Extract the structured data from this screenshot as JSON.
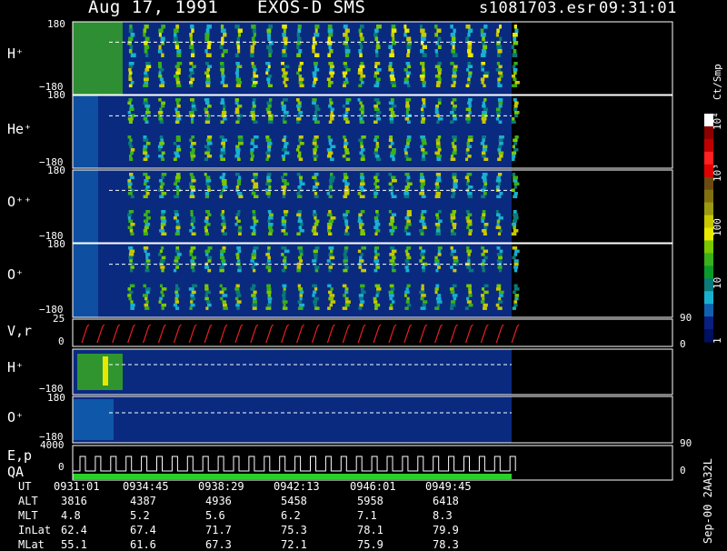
{
  "header": {
    "date": "Aug 17, 1991",
    "instrument": "EXOS-D SMS",
    "file": "s1081703.esr",
    "time": "09:31:01"
  },
  "colorbar": {
    "unit": "Ct/Smp",
    "ticks": [
      "1",
      "10",
      "100",
      "10³",
      "10⁴"
    ],
    "colors": [
      "#ffffff",
      "#8b0000",
      "#c00000",
      "#ff2020",
      "#e00000",
      "#6b4a12",
      "#807010",
      "#9a9a10",
      "#c8c800",
      "#e8e800",
      "#7ac800",
      "#3ab01a",
      "#0a9a2a",
      "#0a7a7a",
      "#19b0d0",
      "#1060b0",
      "#0a2080",
      "#001060"
    ]
  },
  "chart_data": [
    {
      "type": "heatmap",
      "panel": "H+",
      "label": "H⁺",
      "ylim": [
        -180,
        180
      ],
      "y_ticks": [
        "180",
        "−180"
      ]
    },
    {
      "type": "heatmap",
      "panel": "He+",
      "label": "He⁺",
      "ylim": [
        -180,
        180
      ],
      "y_ticks": [
        "180",
        "−180"
      ]
    },
    {
      "type": "heatmap",
      "panel": "O++",
      "label": "O⁺⁺",
      "ylim": [
        -180,
        180
      ],
      "y_ticks": [
        "180",
        "−180"
      ]
    },
    {
      "type": "heatmap",
      "panel": "O+",
      "label": "O⁺",
      "ylim": [
        -180,
        180
      ],
      "y_ticks": [
        "180",
        "−180"
      ]
    },
    {
      "type": "line",
      "panel": "V,r",
      "label": "V,r",
      "ylim": [
        0,
        25
      ],
      "y_ticks": [
        "25",
        "0"
      ],
      "right_ticks": [
        "90",
        "0"
      ]
    },
    {
      "type": "heatmap",
      "panel": "H+ (2)",
      "label": "H⁺",
      "ylim": [
        -180,
        180
      ],
      "y_ticks": [
        "180",
        "−180"
      ]
    },
    {
      "type": "heatmap",
      "panel": "O+ (2)",
      "label": "O⁺",
      "ylim": [
        -180,
        180
      ],
      "y_ticks": [
        "180",
        "−180"
      ],
      "right_ticks": [
        "90"
      ]
    },
    {
      "type": "line",
      "panel": "E,p QA",
      "label1": "E,p",
      "label2": "QA",
      "ylim": [
        0,
        4000
      ],
      "y_ticks": [
        "4000",
        "0"
      ],
      "right_ticks": [
        "0"
      ]
    }
  ],
  "ephemeris": {
    "rows": [
      {
        "name": "UT",
        "values": [
          "0931:01",
          "0934:45",
          "0938:29",
          "0942:13",
          "0946:01",
          "0949:45"
        ]
      },
      {
        "name": "ALT",
        "values": [
          "3816",
          "4387",
          "4936",
          "5458",
          "5958",
          "6418"
        ]
      },
      {
        "name": "MLT",
        "values": [
          "4.8",
          "5.2",
          "5.6",
          "6.2",
          "7.1",
          "8.3"
        ]
      },
      {
        "name": "InLat",
        "values": [
          "62.4",
          "67.4",
          "71.7",
          "75.3",
          "78.1",
          "79.9"
        ]
      },
      {
        "name": "MLat",
        "values": [
          "55.1",
          "61.6",
          "67.3",
          "72.1",
          "75.9",
          "78.3"
        ]
      }
    ]
  },
  "footer": {
    "version": "Sep-00 2AA32L"
  }
}
